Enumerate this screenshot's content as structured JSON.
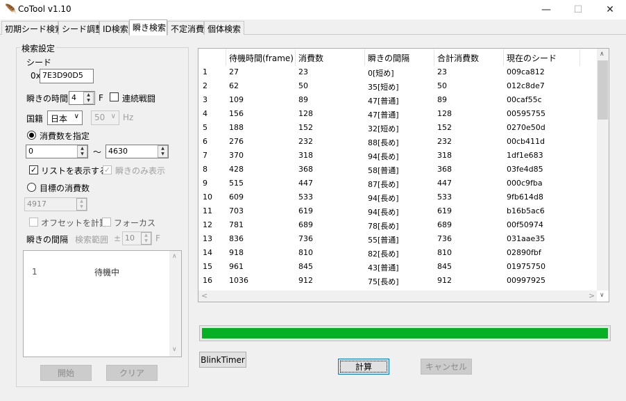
{
  "window": {
    "title": "CoTool v1.10",
    "minimize": "—",
    "maximize": "☐",
    "close": "✕"
  },
  "tabs": [
    "初期シード検索",
    "シード調整",
    "ID検索",
    "瞬き検索",
    "不定消費",
    "個体検索"
  ],
  "active_tab": "瞬き検索",
  "settings": {
    "legend": "検索設定",
    "seed_label": "シード",
    "seed_prefix": "0x",
    "seed_value": "7E3D90D5",
    "blink_time_label": "瞬きの時間",
    "blink_time_value": "4",
    "blink_time_unit": "F",
    "continuous_battle_label": "連続戦闘",
    "continuous_battle_checked": false,
    "region_label": "国籍",
    "region_value": "日本",
    "hz_value": "50",
    "hz_unit": "Hz",
    "specify_consumption_label": "消費数を指定",
    "range_from": "0",
    "range_tilde": "～",
    "range_to": "4630",
    "show_list_label": "リストを表示する",
    "show_list_checked": true,
    "blink_only_label": "瞬きのみ表示",
    "blink_only_checked": true,
    "target_consumption_label": "目標の消費数",
    "target_value": "4917",
    "offset_label": "オフセットを計算",
    "focus_label": "フォーカス",
    "interval_label": "瞬きの間隔",
    "search_range_label": "検索範囲",
    "plus_minus": "±",
    "search_range_value": "10",
    "search_range_unit": "F",
    "start_button": "開始",
    "clear_button": "クリア"
  },
  "listbox": {
    "items": [
      {
        "index": "1",
        "text": "待機中"
      }
    ]
  },
  "table": {
    "columns": [
      "待機時間(frame)",
      "消費数",
      "瞬きの間隔",
      "合計消費数",
      "現在のシード"
    ],
    "rows": [
      [
        "1",
        "27",
        "23",
        "0[短め]",
        "23",
        "009ca812"
      ],
      [
        "2",
        "62",
        "50",
        "35[短め]",
        "50",
        "012c8de7"
      ],
      [
        "3",
        "109",
        "89",
        "47[普通]",
        "89",
        "00caf55c"
      ],
      [
        "4",
        "156",
        "128",
        "47[普通]",
        "128",
        "00595755"
      ],
      [
        "5",
        "188",
        "152",
        "32[短め]",
        "152",
        "0270e50d"
      ],
      [
        "6",
        "276",
        "232",
        "88[長め]",
        "232",
        "00cb411d"
      ],
      [
        "7",
        "370",
        "318",
        "94[長め]",
        "318",
        "1df1e683"
      ],
      [
        "8",
        "428",
        "368",
        "58[普通]",
        "368",
        "03fe4d85"
      ],
      [
        "9",
        "515",
        "447",
        "87[長め]",
        "447",
        "000c9fba"
      ],
      [
        "10",
        "609",
        "533",
        "94[長め]",
        "533",
        "9fb614d8"
      ],
      [
        "11",
        "703",
        "619",
        "94[長め]",
        "619",
        "b16b5ac6"
      ],
      [
        "12",
        "781",
        "689",
        "78[長め]",
        "689",
        "00f50974"
      ],
      [
        "13",
        "836",
        "736",
        "55[普通]",
        "736",
        "031aae35"
      ],
      [
        "14",
        "918",
        "810",
        "82[長め]",
        "810",
        "02890fbf"
      ],
      [
        "15",
        "961",
        "845",
        "43[普通]",
        "845",
        "01975750"
      ],
      [
        "16",
        "1036",
        "912",
        "75[長め]",
        "912",
        "00997925"
      ]
    ]
  },
  "progress": {
    "value": 1.0,
    "color": "#06b025"
  },
  "buttons": {
    "blinktimer": "BlinkTimer",
    "calculate": "計算",
    "cancel": "キャンセル"
  }
}
